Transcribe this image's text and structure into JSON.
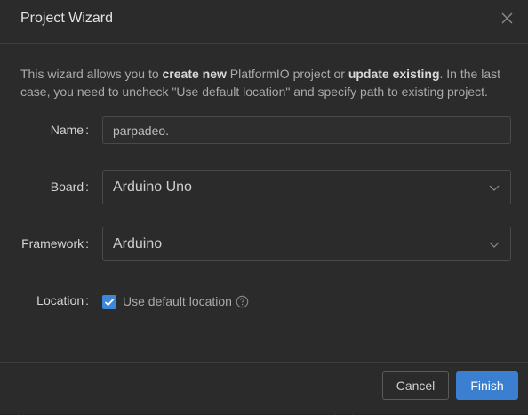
{
  "dialog": {
    "title": "Project Wizard"
  },
  "intro": {
    "part1": "This wizard allows you to ",
    "bold1": "create new",
    "part2": " PlatformIO project or ",
    "bold2": "update existing",
    "part3": ". In the last case, you need to uncheck \"Use default location\" and specify path to existing project."
  },
  "form": {
    "name_label": "Name",
    "name_value": "parpadeo.",
    "board_label": "Board",
    "board_value": "Arduino Uno",
    "framework_label": "Framework",
    "framework_value": "Arduino",
    "location_label": "Location",
    "use_default_location_label": "Use default location",
    "use_default_location_checked": true,
    "colon": ":"
  },
  "buttons": {
    "cancel": "Cancel",
    "finish": "Finish"
  },
  "colors": {
    "accent": "#3b7fd1",
    "dialog_bg": "#2b2b2b"
  },
  "icons": {
    "close": "close-icon",
    "chevron": "chevron-down-icon",
    "check": "checkmark-icon",
    "help": "help-icon"
  }
}
